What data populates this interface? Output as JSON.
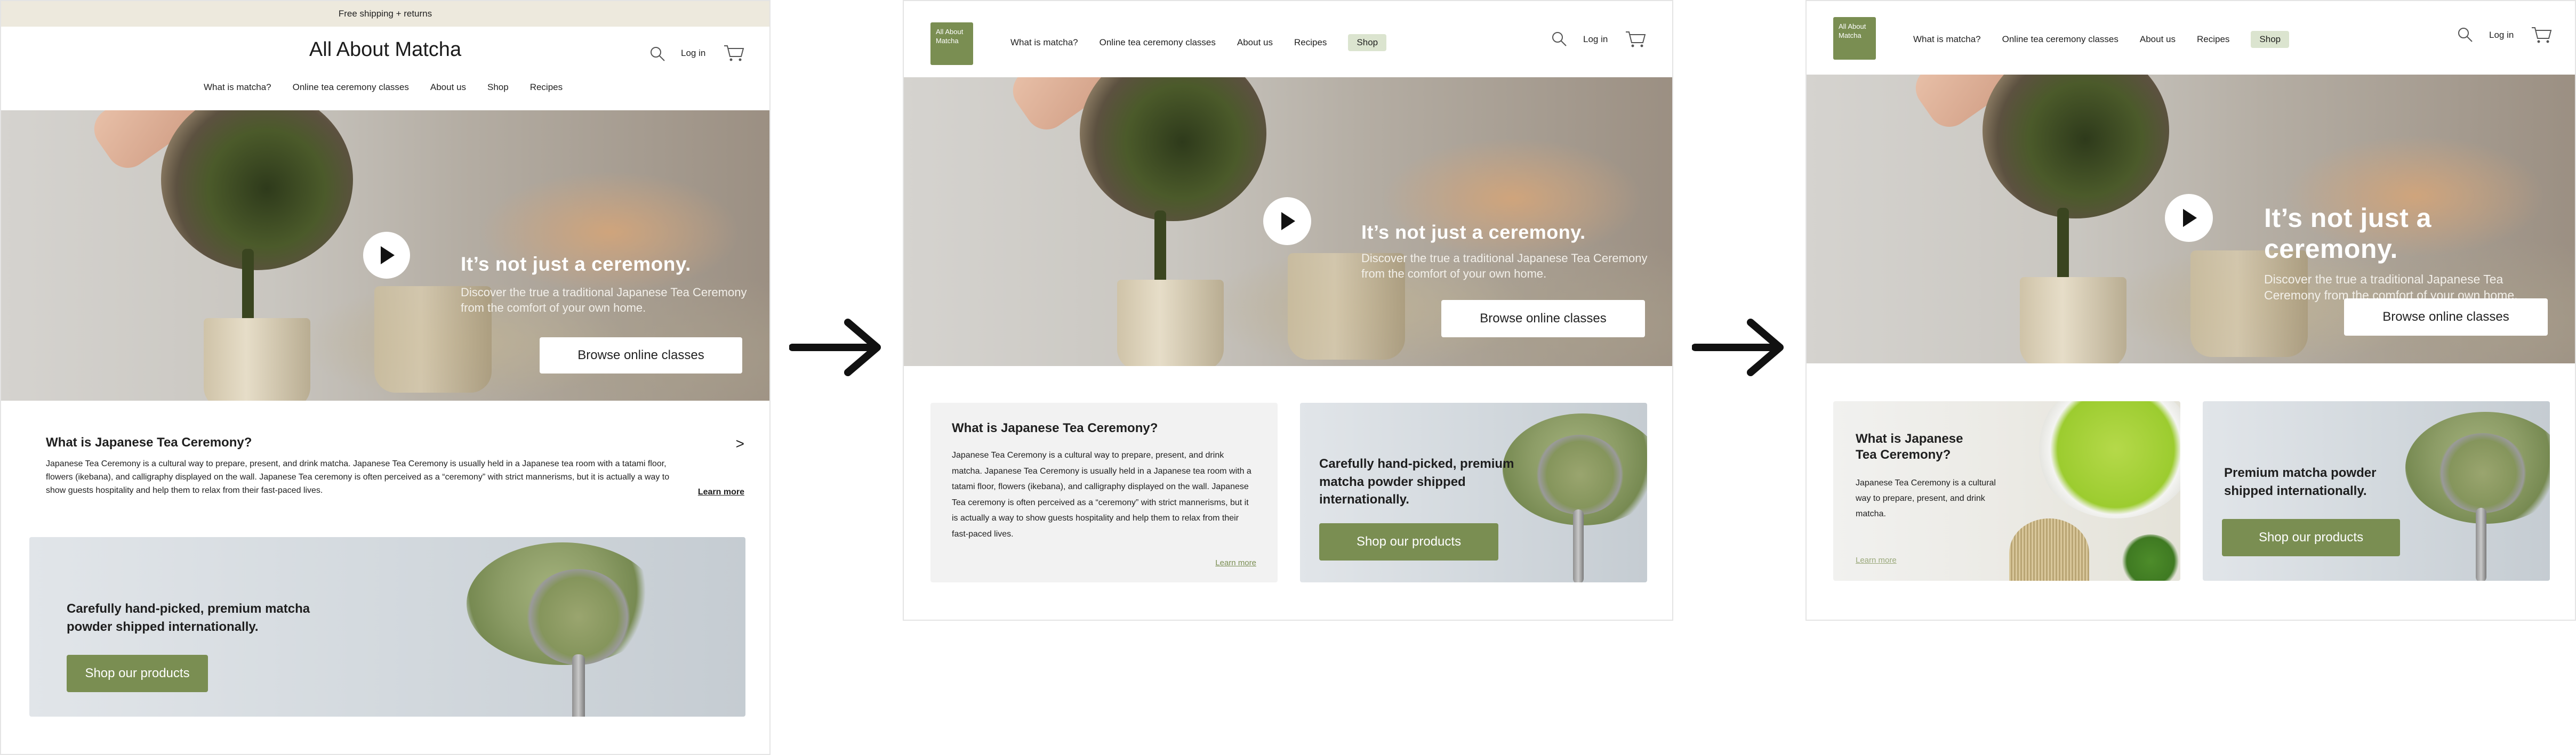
{
  "frame1": {
    "banner": "Free shipping + returns",
    "logo": "All About Matcha",
    "login": "Log in",
    "nav": [
      "What is matcha?",
      "Online tea ceremony classes",
      "About us",
      "Shop",
      "Recipes"
    ],
    "hero": {
      "headline": "It’s not just a ceremony.",
      "sub": "Discover the true a traditional Japanese Tea Ceremony from the comfort of your own home.",
      "button": "Browse online classes"
    },
    "section": {
      "title": "What is Japanese Tea Ceremony?",
      "chevron": ">",
      "body": "Japanese Tea Ceremony is a cultural way to prepare, present, and drink matcha. Japanese Tea Ceremony is usually held in a Japanese tea room with a tatami floor, flowers (ikebana), and calligraphy displayed on the wall. Japanese Tea ceremony is often perceived as a “ceremony” with strict mannerisms, but it is actually a way to show guests hospitality and help them to relax from their fast-paced lives.",
      "learn_more": "Learn more"
    },
    "promo": {
      "text": "Carefully hand-picked, premium matcha powder shipped internationally.",
      "button": "Shop our products"
    }
  },
  "frame2": {
    "logo": "All About Matcha",
    "nav": [
      "What is matcha?",
      "Online tea ceremony classes",
      "About us",
      "Recipes"
    ],
    "shop": "Shop",
    "login": "Log in",
    "hero": {
      "headline": "It’s not just a ceremony.",
      "sub": "Discover the true a traditional Japanese Tea Ceremony from the comfort of your own home.",
      "button": "Browse online classes"
    },
    "card": {
      "title": "What is Japanese Tea Ceremony?",
      "body": "Japanese Tea Ceremony is a cultural way to prepare, present, and drink matcha. Japanese Tea Ceremony is usually held in a Japanese tea room with a tatami floor, flowers (ikebana), and calligraphy displayed on the wall. Japanese Tea ceremony is often perceived as a “ceremony” with strict mannerisms, but it is actually a way to show guests hospitality and help them to relax from their fast-paced lives.",
      "learn_more": "Learn more"
    },
    "promo": {
      "text": "Carefully hand-picked, premium matcha powder shipped internationally.",
      "button": "Shop our products"
    }
  },
  "frame3": {
    "logo": "All About Matcha",
    "nav": [
      "What is matcha?",
      "Online tea ceremony classes",
      "About us",
      "Recipes"
    ],
    "shop": "Shop",
    "login": "Log in",
    "hero": {
      "headline": "It’s not just a ceremony.",
      "sub": "Discover the true a traditional Japanese Tea Ceremony from the comfort of your own home.",
      "button": "Browse online classes"
    },
    "card": {
      "title": "What is Japanese Tea Ceremony?",
      "body": "Japanese Tea Ceremony is a cultural way to prepare, present, and drink matcha.",
      "learn_more": "Learn more"
    },
    "promo": {
      "text": "Premium matcha powder shipped internationally.",
      "button": "Shop our products"
    }
  },
  "colors": {
    "accent_green": "#7a8e52",
    "banner_bg": "#ede9dd",
    "shop_pill": "#dbe4cf"
  },
  "icons": [
    "search-icon",
    "cart-icon",
    "play-icon",
    "chevron-right-icon",
    "arrow-right-icon"
  ]
}
